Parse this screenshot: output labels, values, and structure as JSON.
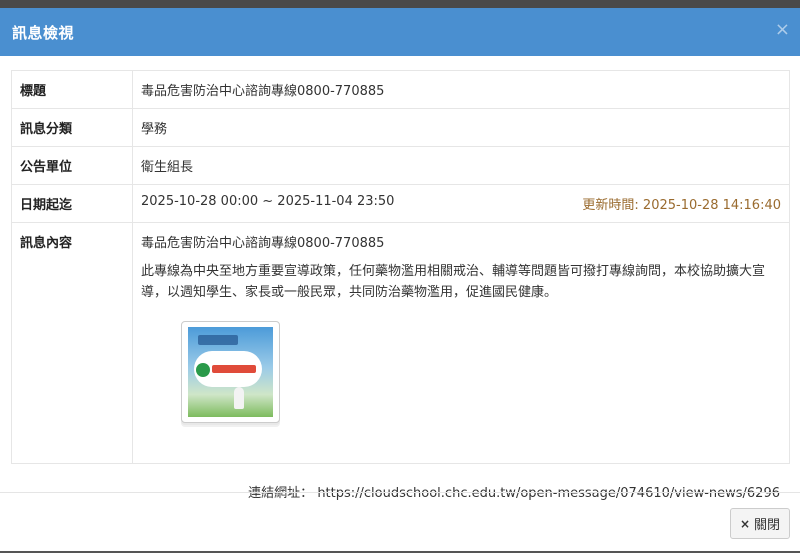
{
  "modal": {
    "title": "訊息檢視",
    "close_symbol": "×"
  },
  "rows": {
    "title_label": "標題",
    "title_value": "毒品危害防治中心諮詢專線0800-770885",
    "category_label": "訊息分類",
    "category_value": "學務",
    "unit_label": "公告單位",
    "unit_value": "衛生組長",
    "date_label": "日期起迄",
    "date_value": "2025-10-28 00:00 ~ 2025-11-04 23:50",
    "updated_value": "更新時間: 2025-10-28 14:16:40",
    "content_label": "訊息內容",
    "content_title": "毒品危害防治中心諮詢專線0800-770885",
    "content_text": "此專線為中央至地方重要宣導政策，任何藥物濫用相關戒治、輔導等問題皆可撥打專線詢問，本校協助擴大宣導，以週知學生、家長或一般民眾，共同防治藥物濫用，促進國民健康。"
  },
  "link": {
    "label": "連結網址：",
    "url": "https://cloudschool.chc.edu.tw/open-message/074610/view-news/6296"
  },
  "footer": {
    "close_icon": "×",
    "close_label": "關閉"
  }
}
